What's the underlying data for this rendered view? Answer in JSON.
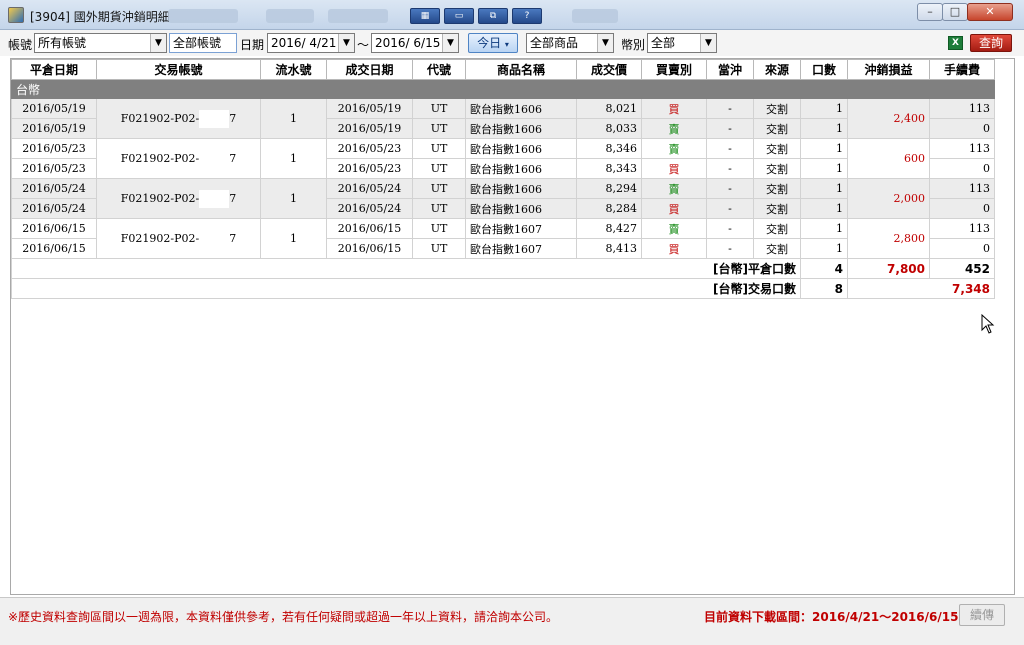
{
  "window": {
    "title": "[3904] 國外期貨沖銷明細",
    "minimize_label": "–",
    "maximize_label": "□",
    "close_label": "✕"
  },
  "toolbar": {
    "account_label": "帳號",
    "account_value": "所有帳號",
    "account_scope": "全部帳號",
    "date_label": "日期",
    "date_from": "2016/ 4/21",
    "tilde": "〜",
    "date_to": "2016/ 6/15",
    "today_label": "今日",
    "product_value": "全部商品",
    "currency_label": "幣別",
    "currency_value": "全部",
    "query_label": "查詢",
    "excel_label": "X"
  },
  "table": {
    "headers": [
      "平倉日期",
      "交易帳號",
      "流水號",
      "成交日期",
      "代號",
      "商品名稱",
      "成交價",
      "買賣別",
      "當沖",
      "來源",
      "口數",
      "沖銷損益",
      "手續費"
    ],
    "group_label": "台幣",
    "pairs": [
      {
        "account_prefix": "F021902-P02-",
        "account_suffix": "7",
        "serial": "1",
        "pnl": "2,400",
        "rows": [
          {
            "close_date": "2016/05/19",
            "trade_date": "2016/05/19",
            "code": "UT",
            "product": "歐台指數1606",
            "price": "8,021",
            "side": "買",
            "daytrade": "-",
            "source": "交割",
            "qty": "1",
            "fee": "113"
          },
          {
            "close_date": "2016/05/19",
            "trade_date": "2016/05/19",
            "code": "UT",
            "product": "歐台指數1606",
            "price": "8,033",
            "side": "賣",
            "daytrade": "-",
            "source": "交割",
            "qty": "1",
            "fee": "0"
          }
        ]
      },
      {
        "account_prefix": "F021902-P02-",
        "account_suffix": "7",
        "serial": "1",
        "pnl": "600",
        "rows": [
          {
            "close_date": "2016/05/23",
            "trade_date": "2016/05/23",
            "code": "UT",
            "product": "歐台指數1606",
            "price": "8,346",
            "side": "賣",
            "daytrade": "-",
            "source": "交割",
            "qty": "1",
            "fee": "113"
          },
          {
            "close_date": "2016/05/23",
            "trade_date": "2016/05/23",
            "code": "UT",
            "product": "歐台指數1606",
            "price": "8,343",
            "side": "買",
            "daytrade": "-",
            "source": "交割",
            "qty": "1",
            "fee": "0"
          }
        ]
      },
      {
        "account_prefix": "F021902-P02-",
        "account_suffix": "7",
        "serial": "1",
        "pnl": "2,000",
        "rows": [
          {
            "close_date": "2016/05/24",
            "trade_date": "2016/05/24",
            "code": "UT",
            "product": "歐台指數1606",
            "price": "8,294",
            "side": "賣",
            "daytrade": "-",
            "source": "交割",
            "qty": "1",
            "fee": "113"
          },
          {
            "close_date": "2016/05/24",
            "trade_date": "2016/05/24",
            "code": "UT",
            "product": "歐台指數1606",
            "price": "8,284",
            "side": "買",
            "daytrade": "-",
            "source": "交割",
            "qty": "1",
            "fee": "0"
          }
        ]
      },
      {
        "account_prefix": "F021902-P02-",
        "account_suffix": "7",
        "serial": "1",
        "pnl": "2,800",
        "rows": [
          {
            "close_date": "2016/06/15",
            "trade_date": "2016/06/15",
            "code": "UT",
            "product": "歐台指數1607",
            "price": "8,427",
            "side": "賣",
            "daytrade": "-",
            "source": "交割",
            "qty": "1",
            "fee": "113"
          },
          {
            "close_date": "2016/06/15",
            "trade_date": "2016/06/15",
            "code": "UT",
            "product": "歐台指數1607",
            "price": "8,413",
            "side": "買",
            "daytrade": "-",
            "source": "交割",
            "qty": "1",
            "fee": "0"
          }
        ]
      }
    ],
    "summary": {
      "close_label": "[台幣]平倉口數",
      "close_qty": "4",
      "close_pnl": "7,800",
      "close_fee": "452",
      "trade_label": "[台幣]交易口數",
      "trade_qty": "8",
      "trade_total": "7,348"
    }
  },
  "footer": {
    "notice": "※歷史資料查詢區間以一週為限，本資料僅供參考，若有任何疑問或超過一年以上資料，請洽詢本公司。",
    "range": "目前資料下載區間：2016/4/21〜2016/6/15",
    "continue_label": "續傳"
  },
  "colors": {
    "buy": "#c00000",
    "sell": "#008000",
    "pnl": "#c00000",
    "group_bg": "#808080"
  }
}
